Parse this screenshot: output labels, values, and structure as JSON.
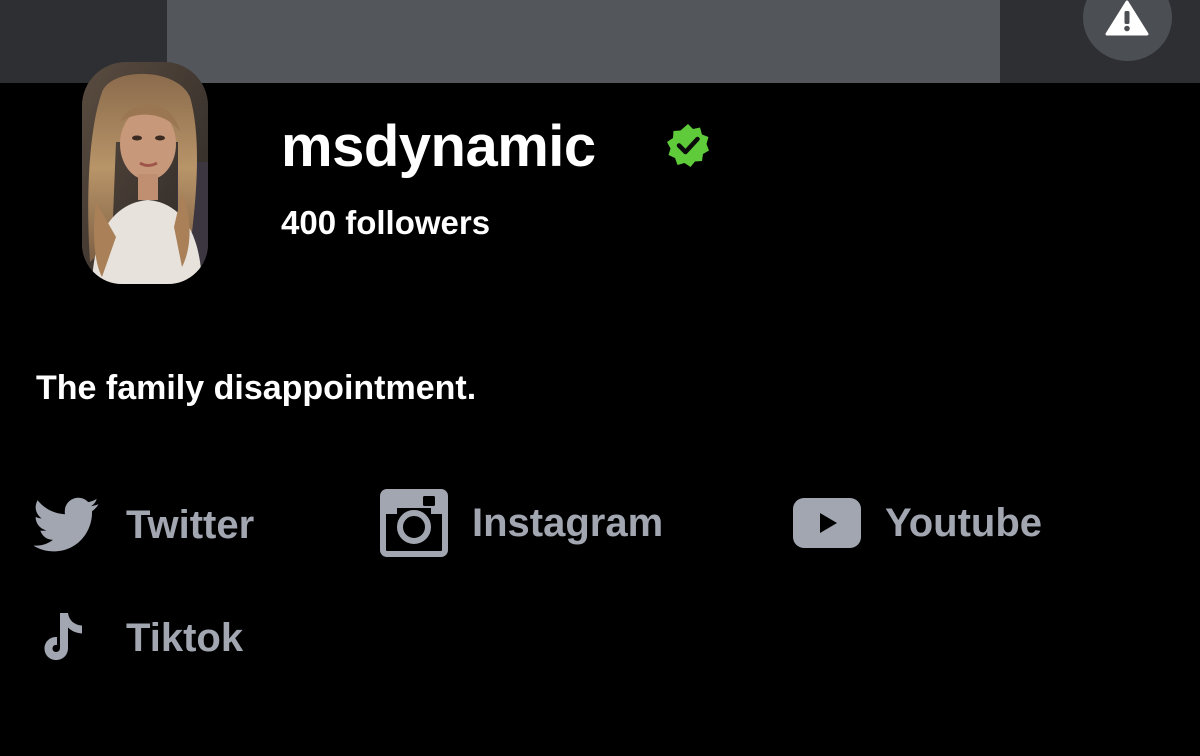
{
  "profile": {
    "username": "msdynamic",
    "followers": "400 followers",
    "bio": "The family disappointment.",
    "verified_color": "#5fcb3a"
  },
  "socials": [
    {
      "label": "Twitter",
      "icon": "twitter-icon"
    },
    {
      "label": "Instagram",
      "icon": "instagram-icon"
    },
    {
      "label": "Youtube",
      "icon": "youtube-icon"
    },
    {
      "label": "Tiktok",
      "icon": "tiktok-icon"
    }
  ],
  "colors": {
    "background": "#000000",
    "banner": "#53575c",
    "banner_edge": "#2d2f32",
    "social_text": "#a1a6b1",
    "text": "#ffffff"
  },
  "icons": {
    "report": "warning-icon"
  }
}
